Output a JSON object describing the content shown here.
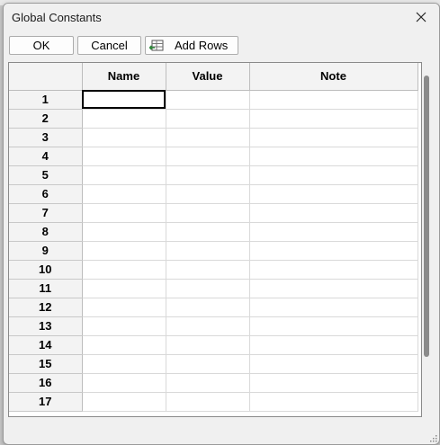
{
  "window": {
    "title": "Global Constants"
  },
  "toolbar": {
    "ok_label": "OK",
    "cancel_label": "Cancel",
    "add_rows_label": "Add Rows"
  },
  "table": {
    "columns": [
      "Name",
      "Value",
      "Note"
    ],
    "rows": [
      "1",
      "2",
      "3",
      "4",
      "5",
      "6",
      "7",
      "8",
      "9",
      "10",
      "11",
      "12",
      "13",
      "14",
      "15",
      "16",
      "17"
    ]
  },
  "icons": {
    "close": "close-icon",
    "add_rows": "table-add-rows-icon",
    "resize": "resize-grip-icon"
  },
  "colors": {
    "selected_cell_border": "#000000",
    "scrollbar": "#8b8b8b"
  }
}
